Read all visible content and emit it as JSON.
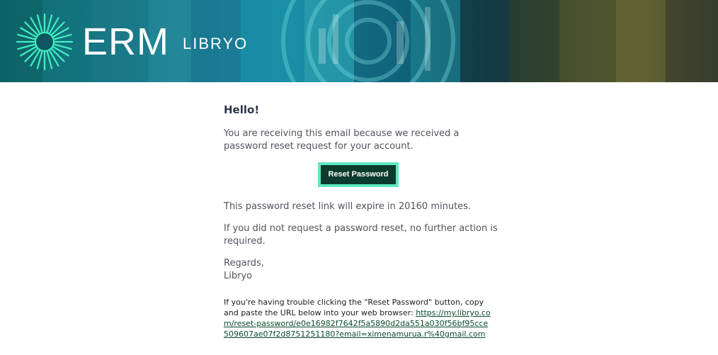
{
  "header": {
    "brand_erm": "ERM",
    "brand_libryo": "LIBRYO",
    "logo_icon": "sunburst-logo-icon",
    "accent_color": "#5ee9c0"
  },
  "email": {
    "greeting": "Hello!",
    "intro": "You are receiving this email because we received a password reset request for your account.",
    "button_label": "Reset Password",
    "expiry": "This password reset link will expire in 20160 minutes.",
    "no_action": "If you did not request a password reset, no further action is required.",
    "regards": "Regards,",
    "signature": "Libryo",
    "trouble_text": "If you're having trouble clicking the \"Reset Password\" button, copy and paste the URL below into your web browser:",
    "reset_url": "https://my.libryo.com/reset-password/e0e16982f7642f5a5890d2da551a030f56bf95cce509607ae07f2d8751251180?email=ximenamurua.r%40gmail.com"
  }
}
